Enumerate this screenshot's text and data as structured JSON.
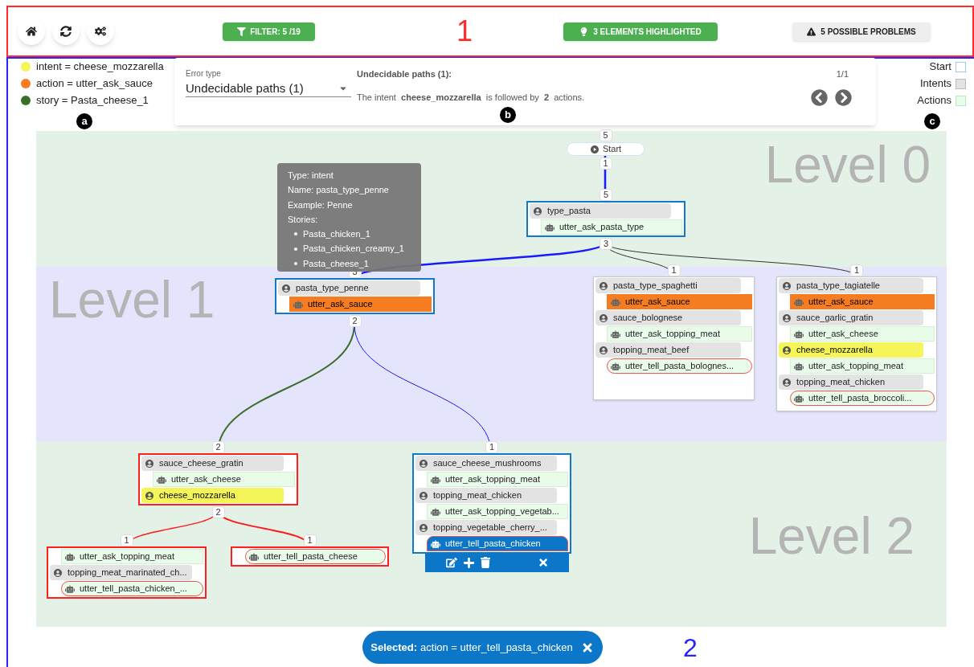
{
  "toolbar": {
    "filter": "FILTER: 5 /19",
    "highlighted": "3 ELEMENTS HIGHLIGHTED",
    "problems": "5 POSSIBLE PROBLEMS"
  },
  "annotations": {
    "header": "1",
    "main": "2",
    "legend": "a",
    "error_panel": "b",
    "node_types": "c"
  },
  "highlight_legend": [
    {
      "label": "intent = cheese_mozzarella",
      "color": "#f5f55a"
    },
    {
      "label": "action = utter_ask_sauce",
      "color": "#f57c20"
    },
    {
      "label": "story = Pasta_cheese_1",
      "color": "#3b6e2a"
    }
  ],
  "error_panel": {
    "field_label": "Error type",
    "field_value": "Undecidable paths (1)",
    "title": "Undecidable paths (1):",
    "message": "The intent  **cheese_mozzarella**  is followed by  **2**  actions.",
    "counter": "1/1"
  },
  "node_types": [
    {
      "label": "Start",
      "kind": "start"
    },
    {
      "label": "Intents",
      "kind": "intent"
    },
    {
      "label": "Actions",
      "kind": "action"
    }
  ],
  "graph": {
    "levels": [
      "Level 0",
      "Level 1",
      "Level 2"
    ],
    "nodes": [
      {
        "kind": "start",
        "label": "Start",
        "count_in": "5",
        "count_out": "1"
      },
      {
        "kind": "group",
        "selected": true,
        "error": false,
        "count_in": "5",
        "count_out": "3",
        "rows": [
          {
            "kind": "intent",
            "label": "type_pasta",
            "selected": false
          },
          {
            "kind": "action",
            "label": "utter_ask_pasta_type",
            "selected": false,
            "end": false
          }
        ]
      },
      {
        "kind": "group",
        "selected": true,
        "error": false,
        "count_in": "3",
        "count_out": "2",
        "rows": [
          {
            "kind": "intent",
            "label": "pasta_type_penne",
            "selected": false
          },
          {
            "kind": "action",
            "label": "utter_ask_sauce",
            "selected": false,
            "end": false,
            "color": "#f57c20"
          }
        ]
      },
      {
        "kind": "group",
        "selected": false,
        "error": false,
        "count_in": "1",
        "rows": [
          {
            "kind": "intent",
            "label": "pasta_type_spaghetti",
            "selected": false
          },
          {
            "kind": "action",
            "label": "utter_ask_sauce",
            "selected": false,
            "end": false,
            "color": "#f57c20"
          },
          {
            "kind": "intent",
            "label": "sauce_bolognese",
            "selected": false
          },
          {
            "kind": "action",
            "label": "utter_ask_topping_meat",
            "selected": false,
            "end": false
          },
          {
            "kind": "intent",
            "label": "topping_meat_beef",
            "selected": false
          },
          {
            "kind": "action",
            "label": "utter_tell_pasta_bolognes...",
            "selected": false,
            "end": true
          }
        ]
      },
      {
        "kind": "group",
        "selected": false,
        "error": false,
        "count_in": "1",
        "rows": [
          {
            "kind": "intent",
            "label": "pasta_type_tagiatelle",
            "selected": false
          },
          {
            "kind": "action",
            "label": "utter_ask_sauce",
            "selected": false,
            "end": false,
            "color": "#f57c20"
          },
          {
            "kind": "intent",
            "label": "sauce_garlic_gratin",
            "selected": false
          },
          {
            "kind": "action",
            "label": "utter_ask_cheese",
            "selected": false,
            "end": false
          },
          {
            "kind": "intent",
            "label": "cheese_mozzarella",
            "selected": false,
            "color": "#f5f55a"
          },
          {
            "kind": "action",
            "label": "utter_ask_topping_meat",
            "selected": false,
            "end": false
          },
          {
            "kind": "intent",
            "label": "topping_meat_chicken",
            "selected": false
          },
          {
            "kind": "action",
            "label": "utter_tell_pasta_broccoli...",
            "selected": false,
            "end": true
          }
        ]
      },
      {
        "kind": "group",
        "selected": false,
        "error": true,
        "count_in": "2",
        "count_out": "2",
        "rows": [
          {
            "kind": "intent",
            "label": "sauce_cheese_gratin",
            "selected": false
          },
          {
            "kind": "action",
            "label": "utter_ask_cheese",
            "selected": false,
            "end": false
          },
          {
            "kind": "intent",
            "label": "cheese_mozzarella",
            "selected": false,
            "color": "#f5f55a"
          }
        ]
      },
      {
        "kind": "group",
        "selected": true,
        "error": false,
        "count_in": "1",
        "rows": [
          {
            "kind": "intent",
            "label": "sauce_cheese_mushrooms",
            "selected": false
          },
          {
            "kind": "action",
            "label": "utter_ask_topping_meat",
            "selected": false,
            "end": false
          },
          {
            "kind": "intent",
            "label": "topping_meat_chicken",
            "selected": false
          },
          {
            "kind": "action",
            "label": "utter_ask_topping_vegetab...",
            "selected": false,
            "end": false
          },
          {
            "kind": "intent",
            "label": "topping_vegetable_cherry_...",
            "selected": false
          },
          {
            "kind": "action",
            "label": "utter_tell_pasta_chicken",
            "selected": true,
            "end": true
          }
        ]
      },
      {
        "kind": "group",
        "selected": false,
        "error": true,
        "count_in": "1",
        "rows": [
          {
            "kind": "action",
            "label": "utter_ask_topping_meat",
            "selected": false,
            "end": false
          },
          {
            "kind": "intent",
            "label": "topping_meat_marinated_ch...",
            "selected": false
          },
          {
            "kind": "action",
            "label": "utter_tell_pasta_chicken_...",
            "selected": false,
            "end": true
          }
        ]
      },
      {
        "kind": "group",
        "selected": false,
        "error": true,
        "count_in": "1",
        "rows": [
          {
            "kind": "action",
            "label": "utter_tell_pasta_cheese",
            "selected": false,
            "end": true
          }
        ]
      }
    ],
    "edges": [
      {
        "kind": "selected"
      },
      {
        "kind": "selected"
      },
      {
        "kind": "plain"
      },
      {
        "kind": "plain"
      },
      {
        "kind": "story"
      },
      {
        "kind": "selected"
      },
      {
        "kind": "error"
      },
      {
        "kind": "error"
      }
    ],
    "tooltip": {
      "lines": [
        "Type: intent",
        "Name: pasta_type_penne",
        "Example: Penne",
        "Stories:"
      ],
      "stories": [
        "Pasta_chicken_1",
        "Pasta_chicken_creamy_1",
        "Pasta_cheese_1"
      ]
    }
  },
  "selection": {
    "label": "Selected:",
    "value": "action = utter_tell_pasta_chicken"
  }
}
